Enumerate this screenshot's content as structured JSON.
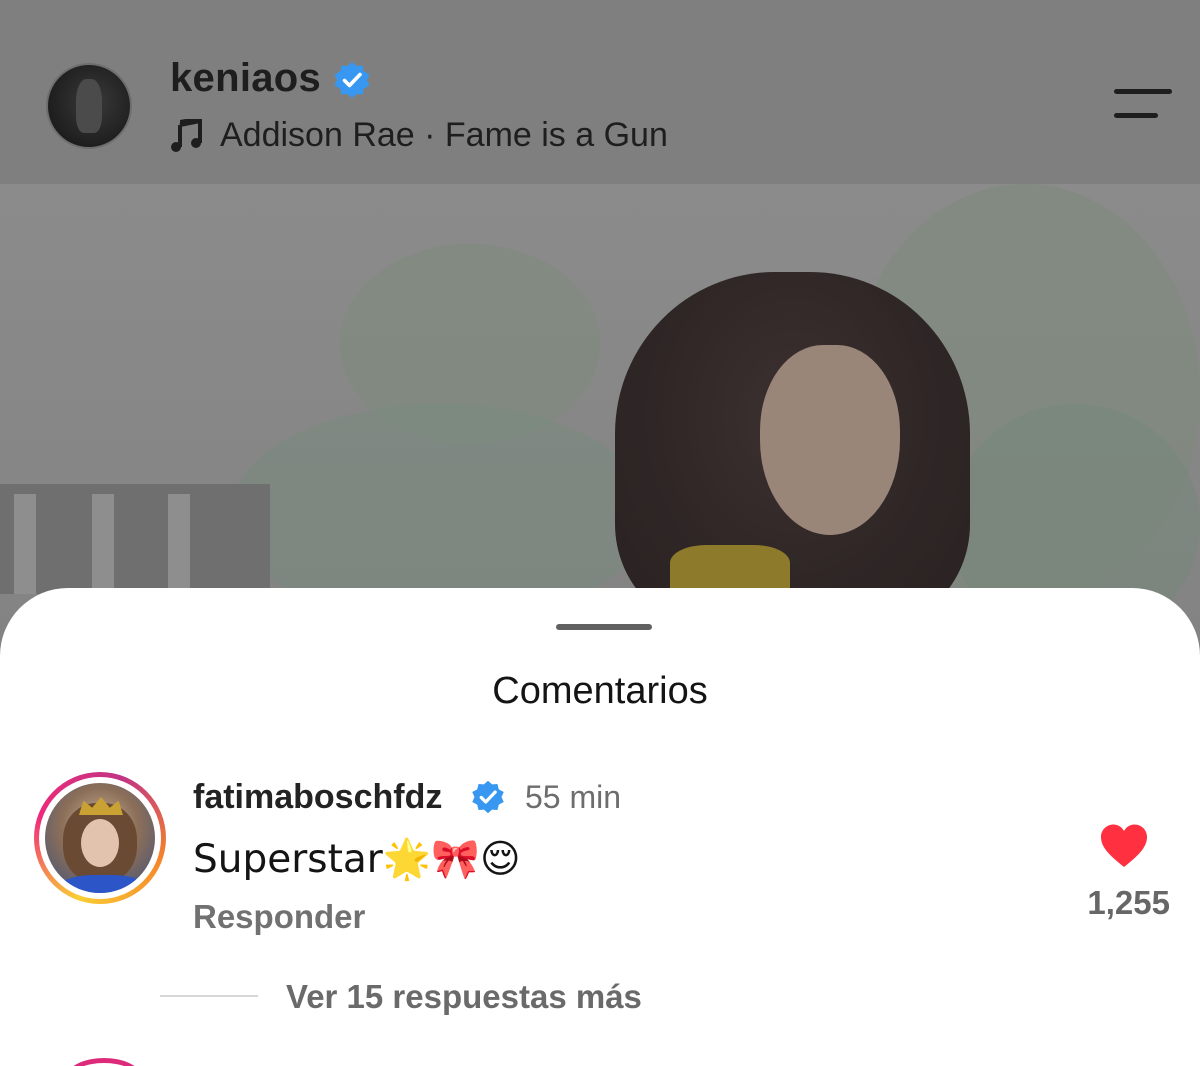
{
  "header": {
    "username": "keniaos",
    "verified": true,
    "music_icon": "music-note-icon",
    "song": "Addison Rae · Fame is a Gun",
    "menu_icon": "menu-icon"
  },
  "comments_sheet": {
    "title": "Comentarios",
    "comments": [
      {
        "username": "fatimaboschfdz",
        "verified": true,
        "time": "55 min",
        "text": "Superstar🌟🎀😌",
        "reply_label": "Responder",
        "likes": "1,255",
        "liked": true,
        "view_replies_label": "Ver 15 respuestas más"
      }
    ]
  },
  "colors": {
    "verified_blue": "#3897f0",
    "like_red": "#ff3040",
    "story_ring": [
      "#f9ce34",
      "#ee2a7b",
      "#c13584"
    ]
  }
}
